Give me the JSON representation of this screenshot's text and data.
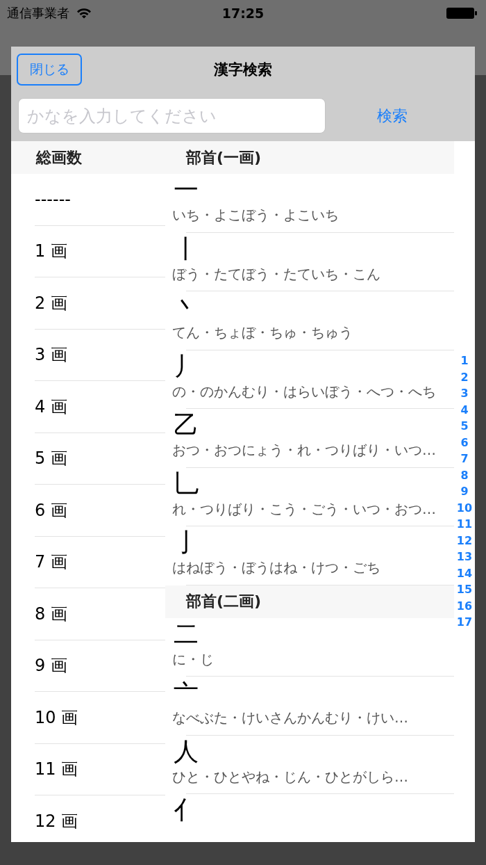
{
  "status_bar": {
    "carrier": "通信事業者",
    "time": "17:25"
  },
  "modal": {
    "close_button": "閉じる",
    "title": "漢字検索",
    "search": {
      "placeholder": "かなを入力してください"
    },
    "search_button": "検索"
  },
  "stroke_column": {
    "header": "総画数",
    "items": [
      "------",
      "1 画",
      "2 画",
      "3 画",
      "4 画",
      "5 画",
      "6 画",
      "7 画",
      "8 画",
      "9 画",
      "10 画",
      "11 画",
      "12 画"
    ]
  },
  "radical_sections": [
    {
      "header": "部首(一画)",
      "rows": [
        {
          "kanji": "一",
          "reading": "いち・よこぼう・よこいち"
        },
        {
          "kanji": "丨",
          "reading": "ぼう・たてぼう・たていち・こん"
        },
        {
          "kanji": "丶",
          "reading": "てん・ちょぼ・ちゅ・ちゅう"
        },
        {
          "kanji": "丿",
          "reading": "の・のかんむり・はらいぼう・へつ・へち"
        },
        {
          "kanji": "乙",
          "reading": "おつ・おつにょう・れ・つりばり・いつ…"
        },
        {
          "kanji": "乚",
          "reading": "れ・つりばり・こう・ごう・いつ・おつ…"
        },
        {
          "kanji": "亅",
          "reading": "はねぼう・ぼうはね・けつ・ごち"
        }
      ]
    },
    {
      "header": "部首(二画)",
      "rows": [
        {
          "kanji": "二",
          "reading": "に・じ"
        },
        {
          "kanji": "亠",
          "reading": "なべぶた・けいさんかんむり・けい…"
        },
        {
          "kanji": "人",
          "reading": "ひと・ひとやね・じん・ひとがしら…"
        },
        {
          "kanji": "亻"
        }
      ]
    }
  ],
  "index": [
    "1",
    "2",
    "3",
    "4",
    "5",
    "6",
    "7",
    "8",
    "9",
    "10",
    "11",
    "12",
    "13",
    "14",
    "15",
    "16",
    "17"
  ]
}
